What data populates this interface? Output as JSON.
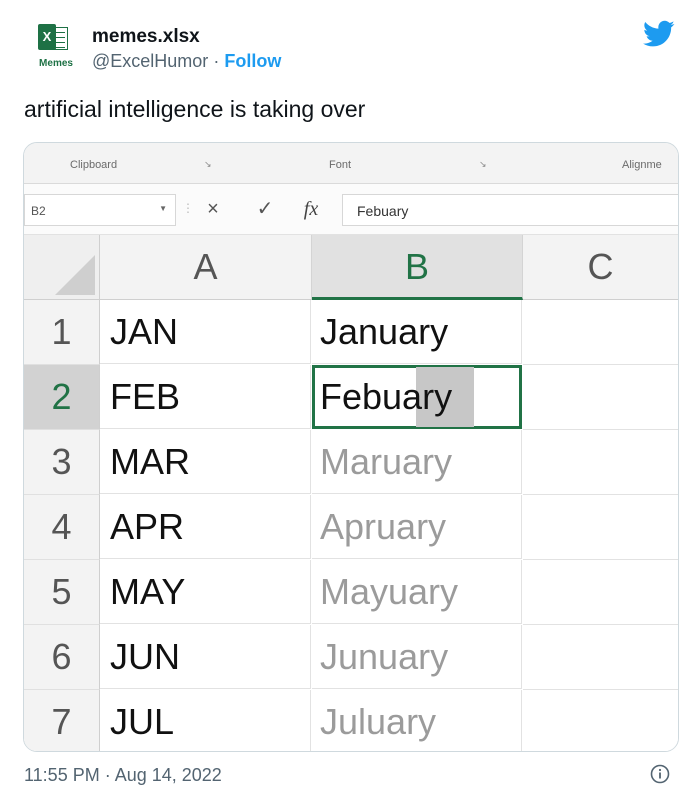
{
  "tweet": {
    "account_name": "memes.xlsx",
    "avatar_label": "Memes",
    "handle": "@ExcelHumor",
    "separator": "·",
    "follow_label": "Follow",
    "text": "artificial intelligence is taking over",
    "timestamp": "11:55 PM · Aug 14, 2022",
    "brand_color": "#1d9bf0"
  },
  "excel": {
    "ribbon": {
      "clipboard": "Clipboard",
      "font": "Font",
      "alignment": "Alignme"
    },
    "name_box": "B2",
    "formula_value": "Febuary",
    "formula_icons": {
      "cancel": "×",
      "enter": "✓",
      "fx": "fx"
    },
    "columns": [
      "A",
      "B",
      "C"
    ],
    "rows": [
      {
        "num": "1",
        "a": "JAN",
        "b": "January"
      },
      {
        "num": "2",
        "a": "FEB",
        "b": "Febuary"
      },
      {
        "num": "3",
        "a": "MAR",
        "b": "Maruary"
      },
      {
        "num": "4",
        "a": "APR",
        "b": "Apruary"
      },
      {
        "num": "5",
        "a": "MAY",
        "b": "Mayuary"
      },
      {
        "num": "6",
        "a": "JUN",
        "b": "Junuary"
      },
      {
        "num": "7",
        "a": "JUL",
        "b": "Juluary"
      }
    ],
    "accent_color": "#217346"
  }
}
